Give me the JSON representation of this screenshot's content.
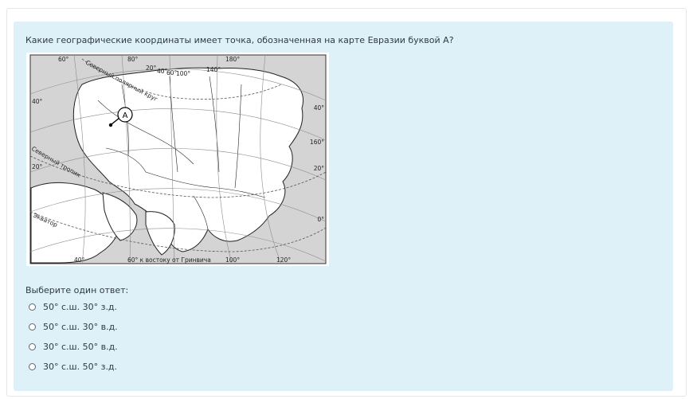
{
  "question": {
    "text": "Какие географические координаты имеет точка, обозначенная на карте Евразии буквой А?"
  },
  "map": {
    "top_labels": [
      "60°",
      "80°",
      "20°",
      "40°",
      "60°",
      "100°",
      "140°",
      "180°"
    ],
    "left_labels": [
      "40°",
      "20°"
    ],
    "right_labels": [
      "40°",
      "160°",
      "20°",
      "0°"
    ],
    "bottom_labels": [
      "40°",
      "60° к востоку от Гринвича",
      "100°",
      "120°"
    ],
    "curve_labels": [
      "Северный полярный круг",
      "Северный тропик",
      "Экватор"
    ],
    "point_label": "А"
  },
  "answer": {
    "prompt": "Выберите один ответ:",
    "options": [
      {
        "label": "50° с.ш. 30° з.д."
      },
      {
        "label": "50° с.ш. 30° в.д."
      },
      {
        "label": "30° с.ш. 50° в.д."
      },
      {
        "label": "30° с.ш. 50° з.д."
      }
    ]
  }
}
